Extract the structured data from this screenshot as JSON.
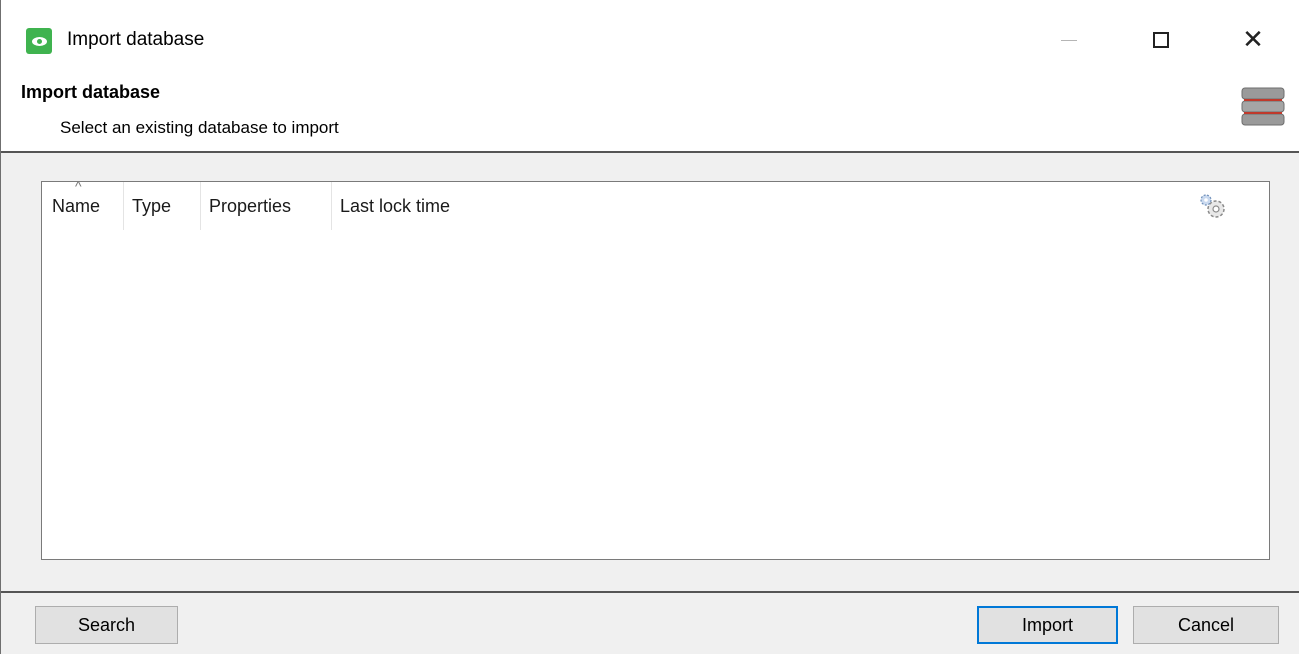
{
  "window": {
    "title": "Import database",
    "close_glyph": "✕"
  },
  "header": {
    "title": "Import database",
    "subtitle": "Select an existing database to import"
  },
  "list": {
    "columns": [
      "Name",
      "Type",
      "Properties",
      "Last lock time"
    ],
    "sort_indicator": "^",
    "rows": []
  },
  "buttons": {
    "search": "Search",
    "import": "Import",
    "cancel": "Cancel"
  },
  "colors": {
    "app_icon": "#3fb34f",
    "default_button_border": "#0078d7",
    "db_stripe": "#c0392b"
  },
  "icons": {
    "app": "eye-icon",
    "header": "database-icon",
    "column_settings": "gear-icon"
  }
}
